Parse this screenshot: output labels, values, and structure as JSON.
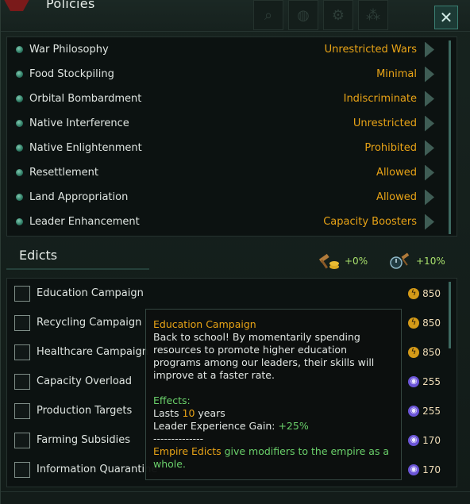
{
  "window": {
    "title": "Policies"
  },
  "header_icons": [
    "search-icon",
    "globe-icon",
    "gear-icon",
    "nodes-icon",
    "hex-icon"
  ],
  "close_label": "✕",
  "policies": [
    {
      "name": "War Philosophy",
      "value": "Unrestricted Wars"
    },
    {
      "name": "Food Stockpiling",
      "value": "Minimal"
    },
    {
      "name": "Orbital Bombardment",
      "value": "Indiscriminate"
    },
    {
      "name": "Native Interference",
      "value": "Unrestricted"
    },
    {
      "name": "Native Enlightenment",
      "value": "Prohibited"
    },
    {
      "name": "Resettlement",
      "value": "Allowed"
    },
    {
      "name": "Land Appropriation",
      "value": "Allowed"
    },
    {
      "name": "Leader Enhancement",
      "value": "Capacity Boosters"
    }
  ],
  "edicts": {
    "title": "Edicts",
    "stat1": "+0%",
    "stat2": "+10%",
    "items": [
      {
        "name": "Education Campaign",
        "cost": "850",
        "currency": "energy"
      },
      {
        "name": "Recycling Campaign",
        "cost": "850",
        "currency": "energy"
      },
      {
        "name": "Healthcare Campaign",
        "cost": "850",
        "currency": "energy"
      },
      {
        "name": "Capacity Overload",
        "cost": "255",
        "currency": "influence"
      },
      {
        "name": "Production Targets",
        "cost": "255",
        "currency": "influence"
      },
      {
        "name": "Farming Subsidies",
        "cost": "170",
        "currency": "influence"
      },
      {
        "name": "Information Quarantine",
        "cost": "170",
        "currency": "influence"
      }
    ]
  },
  "tooltip": {
    "title": "Education Campaign",
    "body": "Back to school! By momentarily spending resources to promote higher education programs among our leaders, their skills will improve at a faster rate.",
    "effects_label": "Effects:",
    "lasts_prefix": "Lasts ",
    "lasts_value": "10",
    "lasts_suffix": " years",
    "gain_prefix": "Leader Experience Gain: ",
    "gain_value": "+25%",
    "separator": "--------------",
    "footer_link": "Empire Edicts",
    "footer_text": " give modifiers to the empire as a whole."
  },
  "colors": {
    "accent": "#e8a316",
    "positive": "#6ad06a",
    "energy": "#d49a18",
    "influence": "#6b55d8"
  }
}
